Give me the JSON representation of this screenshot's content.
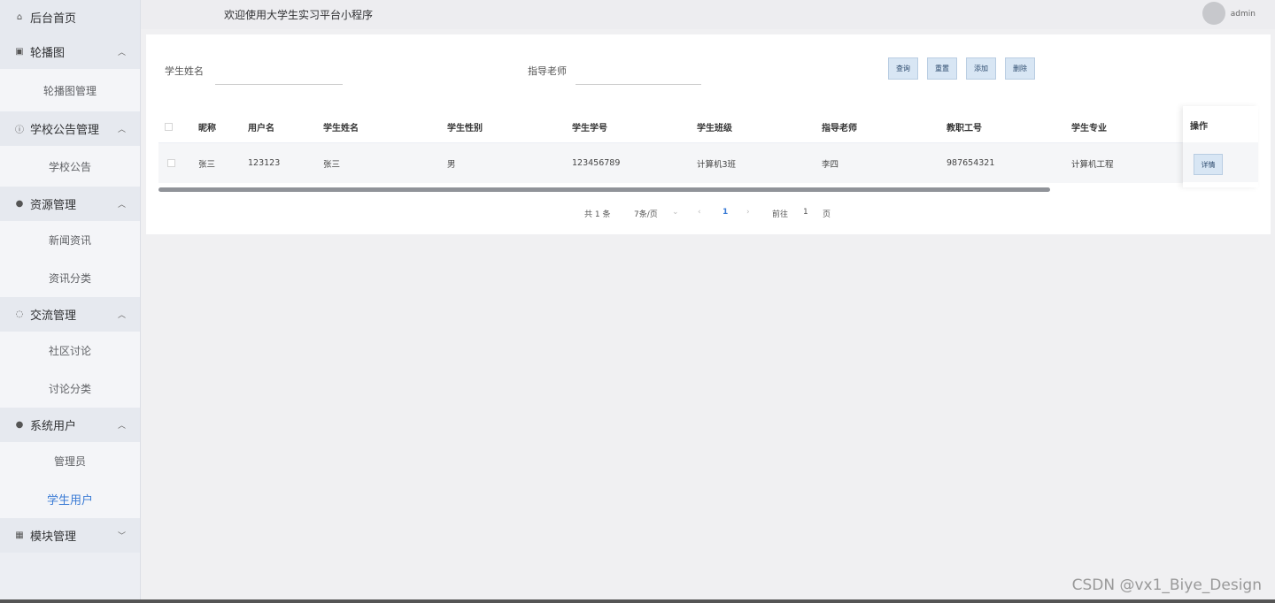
{
  "sidebar": {
    "home": {
      "label": "后台首页",
      "icon": "home-icon"
    },
    "groups": [
      {
        "label": "轮播图",
        "icon": "image-icon",
        "items": [
          "轮播图管理"
        ]
      },
      {
        "label": "学校公告管理",
        "icon": "info-icon",
        "items": [
          "学校公告"
        ]
      },
      {
        "label": "资源管理",
        "icon": "pin-icon",
        "items": [
          "新闻资讯",
          "资讯分类"
        ]
      },
      {
        "label": "交流管理",
        "icon": "chat-icon",
        "items": [
          "社区讨论",
          "讨论分类"
        ]
      },
      {
        "label": "系统用户",
        "icon": "user-icon",
        "items": [
          "管理员",
          "学生用户"
        ],
        "active": "学生用户"
      },
      {
        "label": "模块管理",
        "icon": "grid-icon",
        "items": []
      }
    ]
  },
  "header": {
    "welcome": "欢迎使用大学生实习平台小程序",
    "user": "admin"
  },
  "search": {
    "student_name_label": "学生姓名",
    "teacher_label": "指导老师",
    "student_name_value": "",
    "teacher_value": ""
  },
  "buttons": {
    "query": "查询",
    "reset": "重置",
    "add": "添加",
    "delete": "删除",
    "detail": "详情"
  },
  "table": {
    "columns": [
      "昵称",
      "用户名",
      "学生姓名",
      "学生性别",
      "学生学号",
      "学生班级",
      "指导老师",
      "教职工号",
      "学生专业",
      "操作"
    ],
    "rows": [
      [
        "张三",
        "123123",
        "张三",
        "男",
        "123456789",
        "计算机3班",
        "李四",
        "987654321",
        "计算机工程"
      ]
    ]
  },
  "pagination": {
    "total": "共 1 条",
    "page_size": "7条/页",
    "current": "1",
    "goto_label": "前往",
    "goto_value": "1",
    "page_suffix": "页"
  },
  "watermark": "CSDN @vx1_Biye_Design",
  "colors": {
    "accent": "#3a7bd5",
    "button_bg": "#d8e6f4"
  }
}
